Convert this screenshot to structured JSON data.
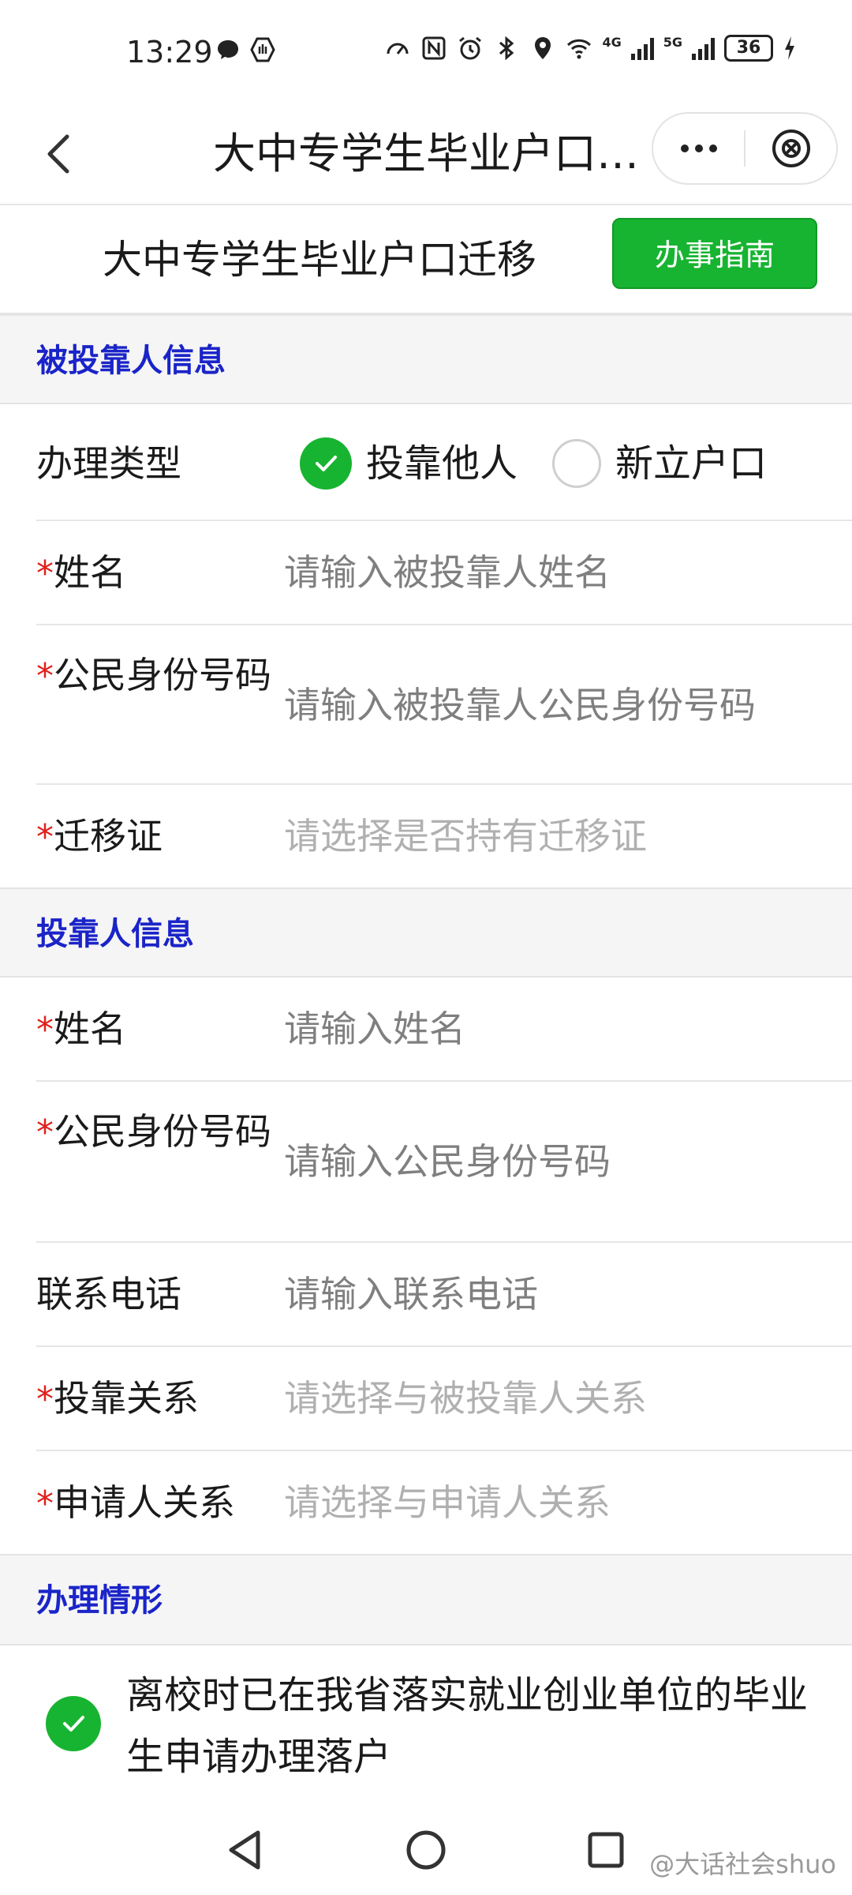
{
  "status_bar": {
    "time": "13:29",
    "battery": "36",
    "net_4g": "4G",
    "net_5g": "5G"
  },
  "nav": {
    "title": "大中专学生毕业户口…"
  },
  "header": {
    "title": "大中专学生毕业户口迁移",
    "guide_button": "办事指南"
  },
  "sections": {
    "dependent": "被投靠人信息",
    "host": "投靠人信息",
    "situation": "办理情形"
  },
  "dependent": {
    "type_label": "办理类型",
    "type_options": [
      "投靠他人",
      "新立户口"
    ],
    "type_selected": "投靠他人",
    "name_label": "姓名",
    "name_placeholder": "请输入被投靠人姓名",
    "id_label": "公民身份号码",
    "id_placeholder": "请输入被投靠人公民身份号码",
    "cert_label": "迁移证",
    "cert_placeholder": "请选择是否持有迁移证"
  },
  "host": {
    "name_label": "姓名",
    "name_placeholder": "请输入姓名",
    "id_label": "公民身份号码",
    "id_placeholder": "请输入公民身份号码",
    "phone_label": "联系电话",
    "phone_placeholder": "请输入联系电话",
    "relation_label": "投靠关系",
    "relation_placeholder": "请选择与被投靠人关系",
    "applicant_label": "申请人关系",
    "applicant_placeholder": "请选择与申请人关系"
  },
  "situation": {
    "option_text": "离校时已在我省落实就业创业单位的毕业生申请办理落户"
  },
  "required_mark": "*",
  "watermark": "@大话社会shuo",
  "colors": {
    "accent_green": "#17b431",
    "section_blue": "#1a24c8",
    "required_red": "#e0201a"
  }
}
